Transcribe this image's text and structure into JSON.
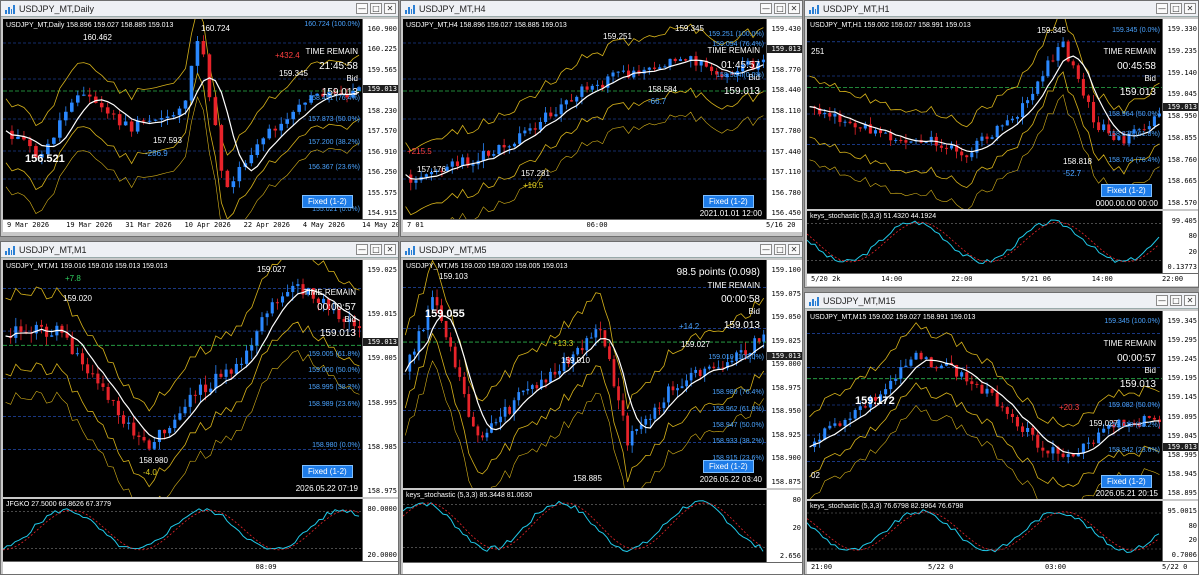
{
  "colors": {
    "up": "#2a88ff",
    "down": "#e8232a",
    "bb": "#d6b21a",
    "ma": "#ffffff",
    "blueMa": "#1f62ff",
    "green": "#2bb24c",
    "cyan": "#20c8e8",
    "magenta": "#ff4cd0"
  },
  "windows": {
    "daily": {
      "title": "USDJPY_MT,Daily",
      "header": "USDJPY_MT,Daily  158.896 159.027 158.885 159.013",
      "time_remain": "TIME REMAIN",
      "remain": "21:45:58",
      "bid_label": "Bid",
      "bid": "159.013",
      "big_label": "156.521",
      "fixed": "Fixed (1-2)",
      "ann": [
        "160.462",
        "160.724",
        "+432.4",
        "159.345",
        "157.593",
        "-286.9"
      ],
      "levels": [
        "160.724 (100.0%)",
        "158.451 (76.4%)",
        "157.873 (50.0%)",
        "157.200 (38.2%)",
        "156.367 (23.6%)",
        "155.021 (0.0%)"
      ],
      "prices": [
        "160.900",
        "160.225",
        "159.565",
        "158.905",
        "158.230",
        "157.570",
        "156.910",
        "156.250",
        "155.575",
        "154.915"
      ],
      "current": "159.013",
      "times": [
        "9 Mar 2026",
        "19 Mar 2026",
        "31 Mar 2026",
        "10 Apr 2026",
        "22 Apr 2026",
        "4 May 2026",
        "14 May 2026"
      ]
    },
    "h4": {
      "title": "USDJPY_MT,H4",
      "header": "USDJPY_MT,H4  158.896 159.027 158.885 159.013",
      "time_remain": "TIME REMAIN",
      "remain": "01:45:57",
      "bid_label": "Bid",
      "bid": "159.013",
      "fixed": "Fixed (1-2)",
      "date": "2021.01.01 12:00",
      "ann": [
        "159.345",
        "159.251",
        "158.584",
        "-66.7",
        "+215.5",
        "157.176",
        "157.281",
        "+10.5"
      ],
      "levels": [
        "159.251 (100.0%)",
        "159.094 (76.4%)",
        "158.584 (0.0%)"
      ],
      "prices": [
        "159.430",
        "159.100",
        "158.770",
        "158.440",
        "158.110",
        "157.780",
        "157.440",
        "157.110",
        "156.780",
        "156.450"
      ],
      "current": "159.013",
      "times": [
        "7 01",
        "06:00",
        "5/16 20"
      ]
    },
    "h1": {
      "title": "USDJPY_MT,H1",
      "header": "USDJPY_MT,H1  159.002 159.027 158.991 159.013",
      "time_remain": "TIME REMAIN",
      "remain": "00:45:58",
      "bid_label": "Bid",
      "bid": "159.013",
      "fixed": "Fixed (1-2)",
      "date": "0000.00.00 00:00",
      "ann": [
        "159.345",
        "251",
        "158.818",
        "-52.7"
      ],
      "levels": [
        "159.345 (0.0%)",
        "158.964 (50.0%)",
        "158.875 (61.8%)",
        "158.764 (76.4%)"
      ],
      "prices": [
        "159.330",
        "159.235",
        "159.140",
        "159.045",
        "158.950",
        "158.855",
        "158.760",
        "158.665",
        "158.570"
      ],
      "current": "159.013",
      "stoch_header": "keys_stochastic (5,3,3) 51.4320 44.1924",
      "stoch_prices": [
        "99.405",
        "80",
        "20",
        "0.13773"
      ],
      "times": [
        "5/20 2k",
        "14:00",
        "22:00",
        "5/21 06",
        "14:00",
        "22:00"
      ]
    },
    "m1": {
      "title": "USDJPY_MT,M1",
      "header": "USDJPY_MT,M1  159.016 159.016 159.013 159.013",
      "time_remain": "TIME REMAIN",
      "remain": "00:00:57",
      "bid_label": "Bid",
      "bid": "159.013",
      "fixed": "Fixed (1-2)",
      "date": "2026.05.22 07:19",
      "ann": [
        "+7.8",
        "159.020",
        "159.027",
        "158.980",
        "-4.0"
      ],
      "levels": [
        "159.005 (61.8%)",
        "159.000 (50.0%)",
        "158.995 (38.2%)",
        "158.989 (23.6%)",
        "158.980 (0.0%)"
      ],
      "prices": [
        "159.025",
        "159.015",
        "159.005",
        "158.995",
        "158.985",
        "158.975"
      ],
      "current": "159.013",
      "ind_header": "JFGKO 27.5000 68.8626 67.3779",
      "ind_prices": [
        "80.0000",
        "20.0000"
      ],
      "times": [
        "08:09"
      ]
    },
    "m5": {
      "title": "USDJPY_MT,M5",
      "header": "USDJPY_MT,M5  159.020 159.020 159.005 159.013",
      "points": "98.5 points (0.098)",
      "time_remain": "TIME REMAIN",
      "remain": "00:00:58",
      "bid_label": "Bid",
      "bid": "159.013",
      "fixed": "Fixed (1-2)",
      "date": "2026.05.22 03:40",
      "big_label": "159.055",
      "ann": [
        "159.103",
        "+13.3",
        "159.010",
        "+14.2",
        "159.027",
        "158.885"
      ],
      "levels": [
        "159.010 (100.0%)",
        "158.980 (76.4%)",
        "158.962 (61.8%)",
        "158.947 (50.0%)",
        "158.933 (38.2%)",
        "158.915 (23.6%)"
      ],
      "prices": [
        "159.100",
        "159.075",
        "159.050",
        "159.025",
        "159.000",
        "158.975",
        "158.950",
        "158.925",
        "158.900",
        "158.875"
      ],
      "current": "159.013",
      "stoch_header": "keys_stochastic (5,3,3) 85.3448 81.0630",
      "stoch_prices": [
        "80",
        "20",
        "2.656"
      ]
    },
    "m15": {
      "title": "USDJPY_MT,M15",
      "header": "USDJPY_MT,M15  159.002 159.027 158.991 159.013",
      "time_remain": "TIME REMAIN",
      "remain": "00:00:57",
      "bid_label": "Bid",
      "bid": "159.013",
      "fixed": "Fixed (1-2)",
      "date": "2026.05.21 20:15",
      "big_label": "159.172",
      "ann": [
        "159.027",
        "+20.3",
        "02"
      ],
      "levels": [
        "159.345 (100.0%)",
        "159.082 (50.0%)",
        "159.019 (38.2%)",
        "158.942 (23.6%)"
      ],
      "prices": [
        "159.345",
        "159.295",
        "159.245",
        "159.195",
        "159.145",
        "159.095",
        "159.045",
        "158.995",
        "158.945",
        "158.895"
      ],
      "current": "159.013",
      "stoch_header": "keys_stochastic (5,3,3) 76.6798 82.9964 76.6798",
      "stoch_prices": [
        "95.0015",
        "80",
        "20",
        "0.7006"
      ],
      "times": [
        "21:00",
        "5/22 0",
        "03:00",
        "5/22 0"
      ]
    }
  }
}
